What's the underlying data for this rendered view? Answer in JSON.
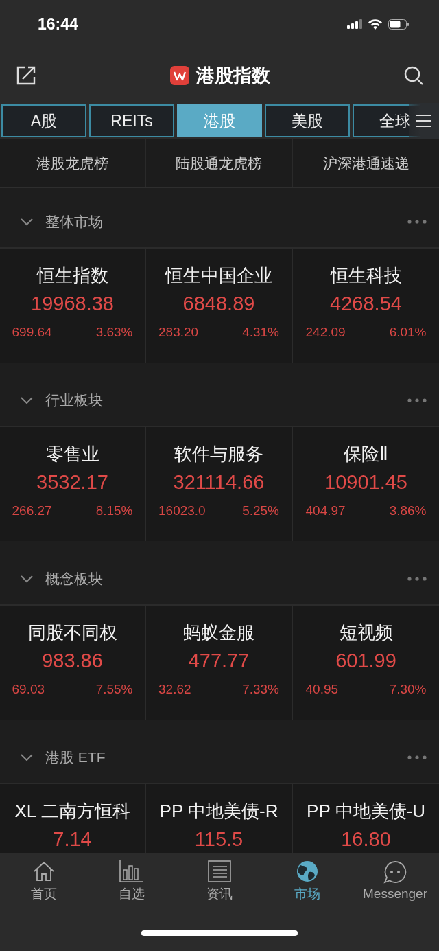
{
  "status_bar": {
    "time": "16:44"
  },
  "header": {
    "title": "港股指数"
  },
  "tabs": [
    {
      "label": "A股",
      "selected": false
    },
    {
      "label": "REITs",
      "selected": false
    },
    {
      "label": "港股",
      "selected": true
    },
    {
      "label": "美股",
      "selected": false
    },
    {
      "label": "全球",
      "selected": false
    }
  ],
  "links": [
    "港股龙虎榜",
    "陆股通龙虎榜",
    "沪深港通速递"
  ],
  "sections": [
    {
      "title": "整体市场",
      "expanded": true,
      "cells": [
        {
          "name": "恒生指数",
          "price": "19968.38",
          "change": "699.64",
          "percent": "3.63%"
        },
        {
          "name": "恒生中国企业",
          "price": "6848.89",
          "change": "283.20",
          "percent": "4.31%"
        },
        {
          "name": "恒生科技",
          "price": "4268.54",
          "change": "242.09",
          "percent": "6.01%"
        }
      ]
    },
    {
      "title": "行业板块",
      "expanded": true,
      "cells": [
        {
          "name": "零售业",
          "price": "3532.17",
          "change": "266.27",
          "percent": "8.15%"
        },
        {
          "name": "软件与服务",
          "price": "321114.66",
          "change": "16023.0",
          "percent": "5.25%"
        },
        {
          "name": "保险Ⅱ",
          "price": "10901.45",
          "change": "404.97",
          "percent": "3.86%"
        }
      ]
    },
    {
      "title": "概念板块",
      "expanded": true,
      "cells": [
        {
          "name": "同股不同权",
          "price": "983.86",
          "change": "69.03",
          "percent": "7.55%"
        },
        {
          "name": "蚂蚁金服",
          "price": "477.77",
          "change": "32.62",
          "percent": "7.33%"
        },
        {
          "name": "短视频",
          "price": "601.99",
          "change": "40.95",
          "percent": "7.30%"
        }
      ]
    },
    {
      "title": "港股 ETF",
      "expanded": true,
      "cells": [
        {
          "name": "XL 二南方恒科",
          "price": "7.14"
        },
        {
          "name": "PP 中地美债-R",
          "price": "115.5"
        },
        {
          "name": "PP 中地美债-U",
          "price": "16.80"
        }
      ]
    }
  ],
  "tab_bar": [
    {
      "label": "首页",
      "kind": "home",
      "selected": false
    },
    {
      "label": "自选",
      "kind": "chart",
      "selected": false
    },
    {
      "label": "资讯",
      "kind": "news",
      "selected": false
    },
    {
      "label": "市场",
      "kind": "globe",
      "selected": true
    },
    {
      "label": "Messenger",
      "kind": "chat",
      "selected": false
    }
  ]
}
